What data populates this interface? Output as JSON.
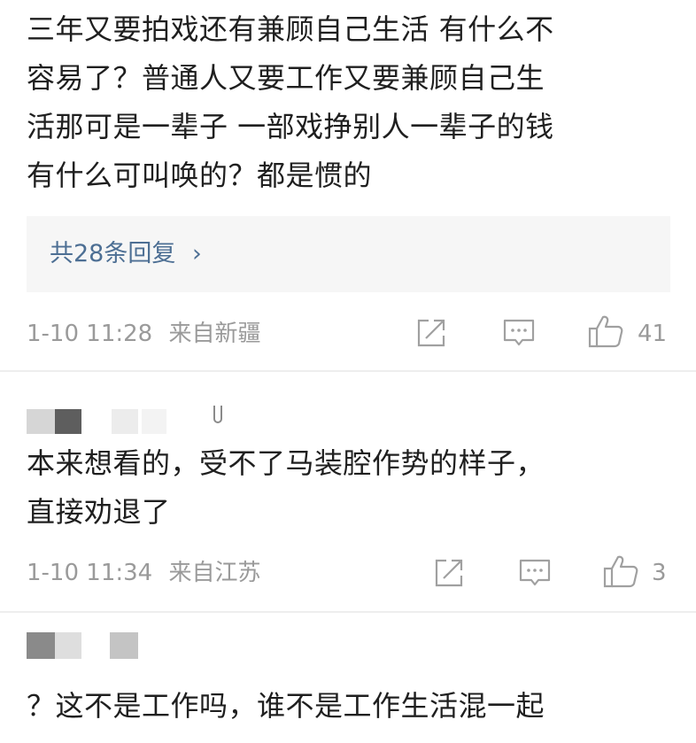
{
  "comments": [
    {
      "lines": [
        "三年又要拍戏还有兼顾自己生活 有什么不",
        "容易了？普通人又要工作又要兼顾自己生",
        "活那可是一辈子 一部戏挣别人一辈子的钱",
        "有什么可叫唤的？都是惯的"
      ],
      "replies_label": "共28条回复",
      "replies_chevron": "›",
      "time": "1-10 11:28",
      "location": "来自新疆",
      "likes": "41"
    },
    {
      "lines": [
        "本来想看的，受不了马装腔作势的样子，",
        "直接劝退了"
      ],
      "time": "1-10 11:34",
      "location": "来自江苏",
      "likes": "3"
    },
    {
      "lines": [
        "？这不是工作吗，谁不是工作生活混一起"
      ]
    }
  ],
  "icons": {
    "share": "share-icon",
    "comment": "comment-icon",
    "like": "thumbs-up-icon"
  },
  "colors": {
    "reply_link": "#4d6f94",
    "meta_text": "#9a9a9a",
    "reply_box_bg": "#f6f6f6"
  }
}
